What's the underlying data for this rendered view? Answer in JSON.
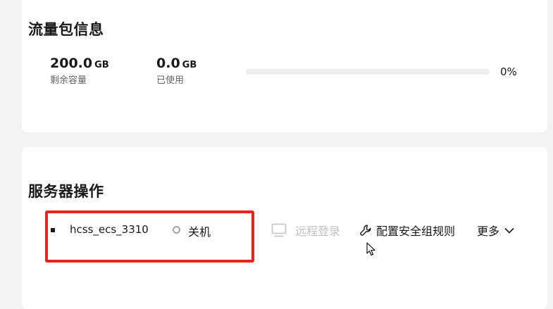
{
  "traffic": {
    "title": "流量包信息",
    "remaining": {
      "value": "200.0",
      "unit": "GB",
      "label": "剩余容量"
    },
    "used": {
      "value": "0.0",
      "unit": "GB",
      "label": "已使用"
    },
    "progress_percent": 0,
    "progress_text": "0%"
  },
  "server": {
    "title": "服务器操作",
    "name": "hcss_ecs_3310",
    "status": "关机",
    "actions": {
      "remote_login": "远程登录",
      "security_rule": "配置安全组规则",
      "more": "更多"
    }
  },
  "colors": {
    "highlight_box": "#e8261f",
    "disabled_text": "#c2c2c2",
    "status_off": "#a3a3a3"
  },
  "icons": {
    "remote_login": "monitor-icon",
    "security_rule": "wrench-icon",
    "more": "chevron-down-icon",
    "status": "status-ring-icon",
    "pointer": "mouse-cursor-icon"
  }
}
